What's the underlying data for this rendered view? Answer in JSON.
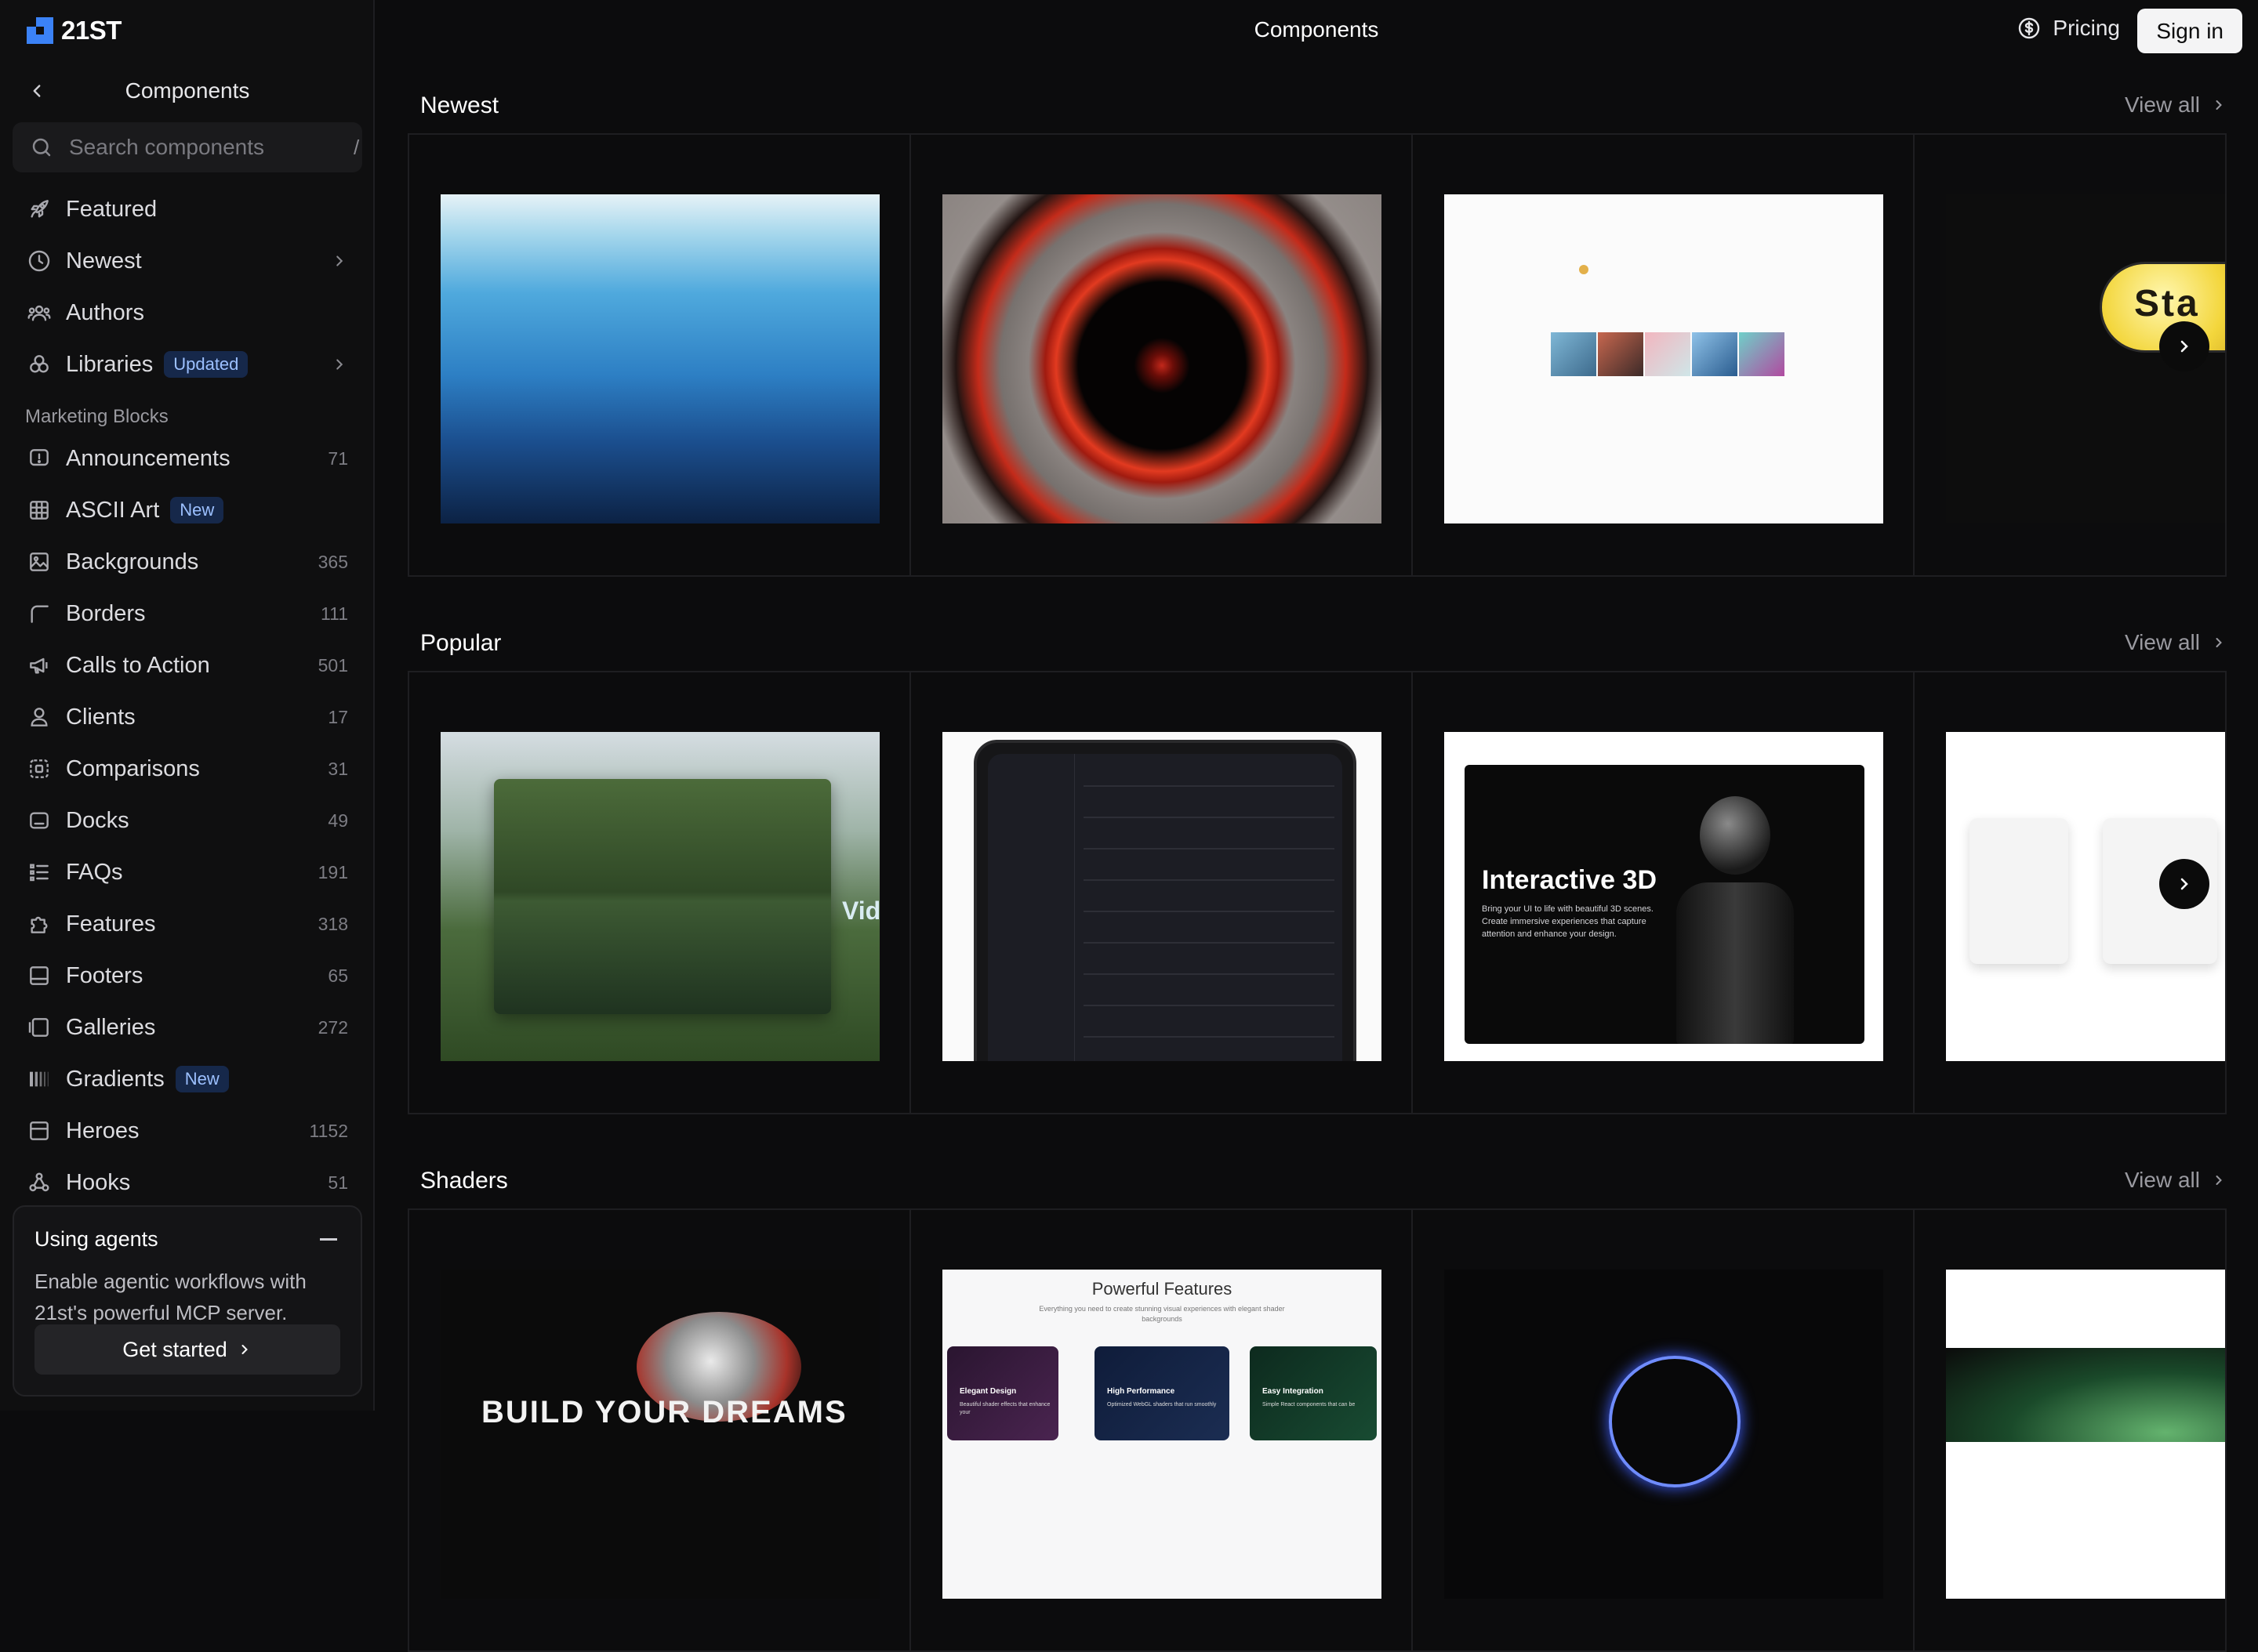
{
  "brand": {
    "name": "21ST"
  },
  "header": {
    "title": "Components",
    "pricing_label": "Pricing",
    "signin_label": "Sign in"
  },
  "sidebar": {
    "title": "Components",
    "search": {
      "placeholder": "Search components",
      "shortcut": "/"
    },
    "top_items": [
      {
        "label": "Featured"
      },
      {
        "label": "Newest"
      },
      {
        "label": "Authors"
      },
      {
        "label": "Libraries",
        "badge": "Updated"
      }
    ],
    "section_label": "Marketing Blocks",
    "items": [
      {
        "label": "Announcements",
        "count": "71"
      },
      {
        "label": "ASCII Art",
        "badge": "New"
      },
      {
        "label": "Backgrounds",
        "count": "365"
      },
      {
        "label": "Borders",
        "count": "111"
      },
      {
        "label": "Calls to Action",
        "count": "501"
      },
      {
        "label": "Clients",
        "count": "17"
      },
      {
        "label": "Comparisons",
        "count": "31"
      },
      {
        "label": "Docks",
        "count": "49"
      },
      {
        "label": "FAQs",
        "count": "191"
      },
      {
        "label": "Features",
        "count": "318"
      },
      {
        "label": "Footers",
        "count": "65"
      },
      {
        "label": "Galleries",
        "count": "272"
      },
      {
        "label": "Gradients",
        "badge": "New"
      },
      {
        "label": "Heroes",
        "count": "1152"
      },
      {
        "label": "Hooks",
        "count": "51"
      }
    ],
    "agents": {
      "title": "Using agents",
      "description": "Enable agentic workflows with 21st's powerful MCP server.",
      "button": "Get started"
    }
  },
  "sections": [
    {
      "title": "Newest",
      "view_all": "View all",
      "partial_text": "Sta"
    },
    {
      "title": "Popular",
      "view_all": "View all",
      "partial_text": "Vid",
      "card3_title": "Interactive 3D",
      "card3_desc": "Bring your UI to life with beautiful 3D scenes. Create immersive experiences that capture attention and enhance your design."
    },
    {
      "title": "Shaders",
      "view_all": "View all",
      "card1_text": "BUILD YOUR DREAMS",
      "card2_title": "Powerful Features",
      "card2_desc": "Everything you need to create stunning visual experiences with elegant shader backgrounds",
      "features": [
        "Elegant Design",
        "High Performance",
        "Easy Integration"
      ],
      "feature_descs": [
        "Beautiful shader effects that enhance your",
        "Optimized WebGL shaders that run smoothly",
        "Simple React components that can be"
      ]
    }
  ],
  "colors": {
    "accent": "#3b82f6",
    "badge_bg": "#16284a",
    "badge_text": "#9cc0ff"
  }
}
